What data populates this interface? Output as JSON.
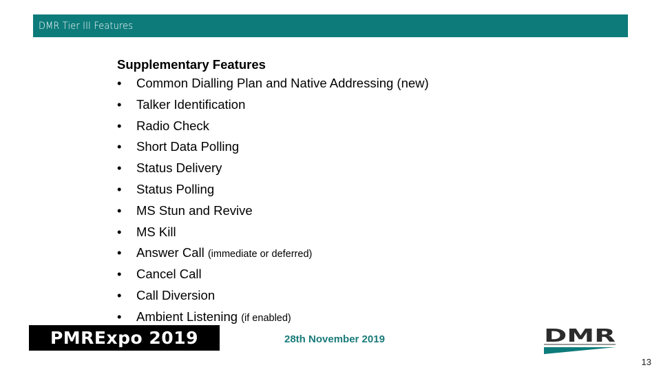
{
  "header": {
    "title": "DMR Tier III Features"
  },
  "content": {
    "heading": "Supplementary Features",
    "bullet_symbol": "•",
    "items": [
      {
        "label": "Common Dialling Plan and Native Addressing (new)",
        "note": ""
      },
      {
        "label": "Talker Identification",
        "note": ""
      },
      {
        "label": "Radio Check",
        "note": ""
      },
      {
        "label": "Short Data Polling",
        "note": ""
      },
      {
        "label": "Status Delivery",
        "note": ""
      },
      {
        "label": "Status Polling",
        "note": ""
      },
      {
        "label": "MS Stun and Revive",
        "note": ""
      },
      {
        "label": "MS Kill",
        "note": ""
      },
      {
        "label": "Answer Call",
        "note": "(immediate or deferred)"
      },
      {
        "label": "Cancel Call",
        "note": ""
      },
      {
        "label": "Call Diversion",
        "note": ""
      },
      {
        "label": "Ambient Listening",
        "note": "(if enabled)"
      }
    ]
  },
  "footer": {
    "event_logo_text": "PMRExpo 2019",
    "date": "28th November 2019",
    "org_logo_text": "DMR",
    "page_number": "13"
  },
  "colors": {
    "accent": "#0e7b7b",
    "date_text": "#1a7a7a",
    "logo_dark": "#2b2b2b"
  }
}
